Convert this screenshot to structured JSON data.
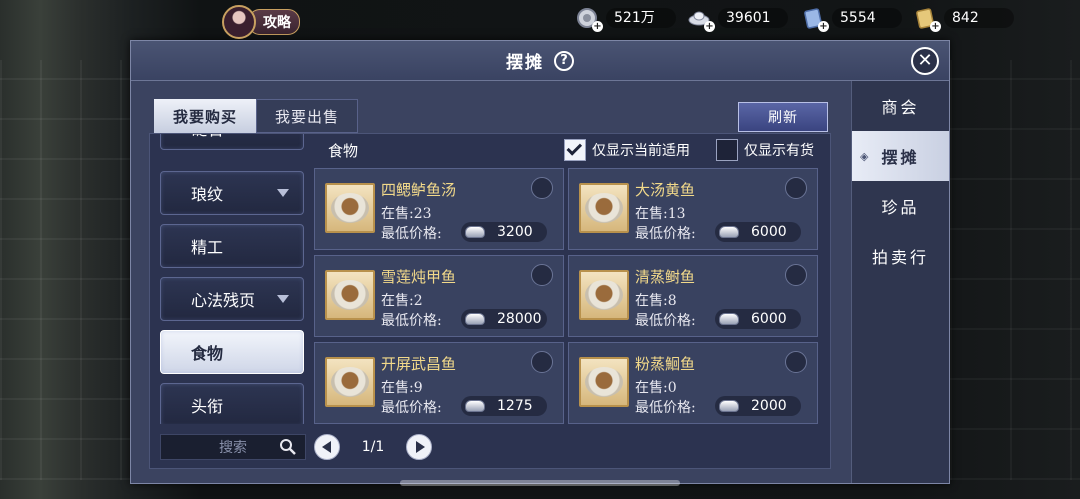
{
  "hud": {
    "guide_label": "攻略",
    "currencies": [
      {
        "icon": "coin-icon",
        "value": "521万"
      },
      {
        "icon": "silver-ingot-icon",
        "value": "39601"
      },
      {
        "icon": "scroll-ticket-icon",
        "value": "5554"
      },
      {
        "icon": "gold-ticket-icon",
        "value": "842"
      }
    ]
  },
  "window": {
    "title": "摆摊",
    "help": "?",
    "close": "✕"
  },
  "right_nav": [
    {
      "label": "商会"
    },
    {
      "label": "摆摊",
      "active": true
    },
    {
      "label": "珍品"
    },
    {
      "label": "拍卖行"
    }
  ],
  "tabs": {
    "buy": "我要购买",
    "sell": "我要出售"
  },
  "refresh_label": "刷新",
  "categories": [
    {
      "label": "砭石",
      "has_arrow": true
    },
    {
      "label": "琅纹",
      "has_arrow": true
    },
    {
      "label": "精工",
      "has_arrow": false
    },
    {
      "label": "心法残页",
      "has_arrow": true
    },
    {
      "label": "食物",
      "has_arrow": false,
      "active": true
    },
    {
      "label": "头衔",
      "has_arrow": false
    }
  ],
  "search_placeholder": "搜索",
  "pager": {
    "text": "1/1"
  },
  "section_title": "食物",
  "filters": {
    "current_applicable": {
      "label": "仅显示当前适用",
      "checked": true
    },
    "in_stock": {
      "label": "仅显示有货",
      "checked": false
    }
  },
  "listing_labels": {
    "stock_prefix": "在售:",
    "price_prefix": "最低价格:"
  },
  "items": [
    {
      "name": "四鳃鲈鱼汤",
      "stock": "在售:23",
      "price_label": "最低价格:",
      "price": "3200"
    },
    {
      "name": "大汤黄鱼",
      "stock": "在售:13",
      "price_label": "最低价格:",
      "price": "6000"
    },
    {
      "name": "雪莲炖甲鱼",
      "stock": "在售:2",
      "price_label": "最低价格:",
      "price": "28000"
    },
    {
      "name": "清蒸鲥鱼",
      "stock": "在售:8",
      "price_label": "最低价格:",
      "price": "6000"
    },
    {
      "name": "开屏武昌鱼",
      "stock": "在售:9",
      "price_label": "最低价格:",
      "price": "1275"
    },
    {
      "name": "粉蒸鮰鱼",
      "stock": "在售:0",
      "price_label": "最低价格:",
      "price": "2000"
    }
  ]
}
